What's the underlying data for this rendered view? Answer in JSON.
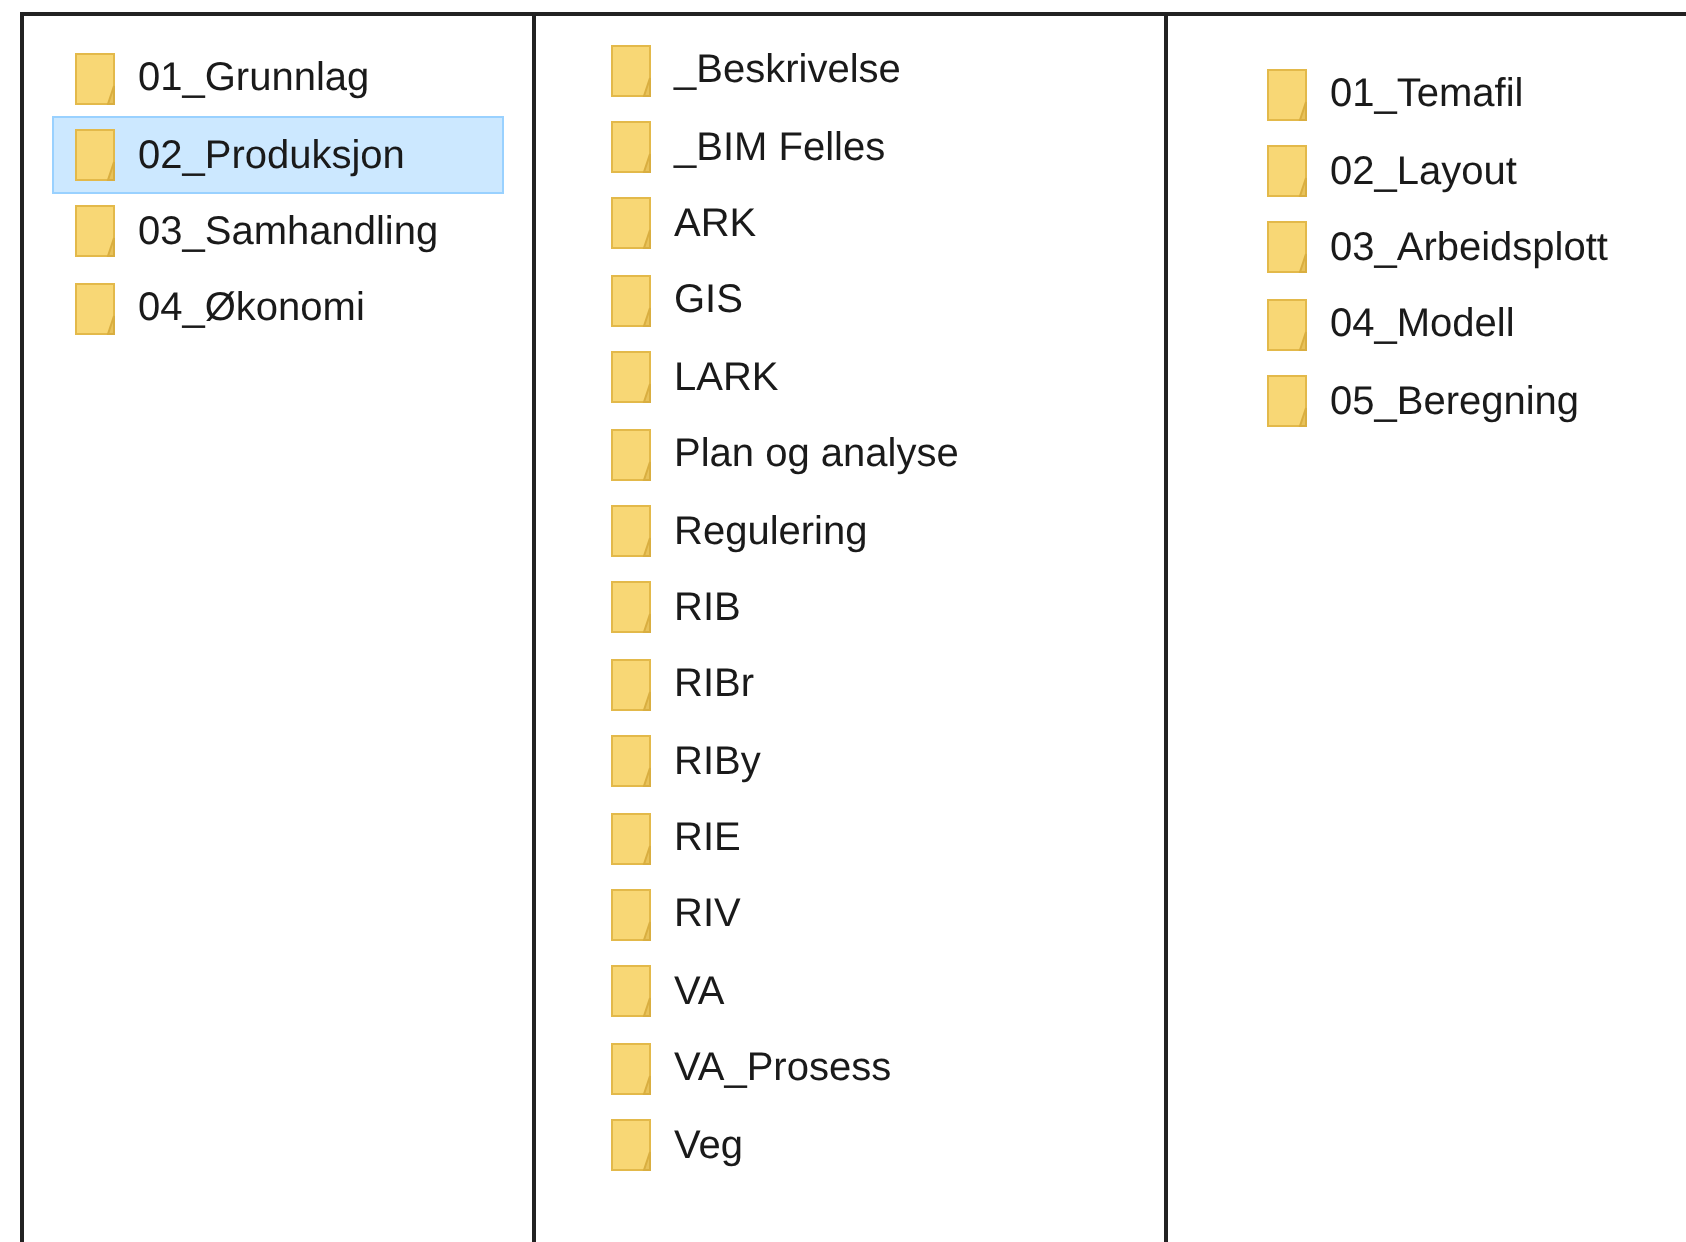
{
  "columns": [
    {
      "items": [
        {
          "label": "01_Grunnlag",
          "selected": false
        },
        {
          "label": "02_Produksjon",
          "selected": true
        },
        {
          "label": "03_Samhandling",
          "selected": false
        },
        {
          "label": "04_Økonomi",
          "selected": false
        }
      ]
    },
    {
      "items": [
        {
          "label": "_Beskrivelse",
          "selected": false
        },
        {
          "label": "_BIM Felles",
          "selected": false
        },
        {
          "label": "ARK",
          "selected": false
        },
        {
          "label": "GIS",
          "selected": false
        },
        {
          "label": "LARK",
          "selected": false
        },
        {
          "label": "Plan og analyse",
          "selected": false
        },
        {
          "label": "Regulering",
          "selected": false
        },
        {
          "label": "RIB",
          "selected": false
        },
        {
          "label": "RIBr",
          "selected": false
        },
        {
          "label": "RIBy",
          "selected": false
        },
        {
          "label": "RIE",
          "selected": false
        },
        {
          "label": "RIV",
          "selected": false
        },
        {
          "label": "VA",
          "selected": false
        },
        {
          "label": "VA_Prosess",
          "selected": false
        },
        {
          "label": "Veg",
          "selected": false
        }
      ]
    },
    {
      "items": [
        {
          "label": "01_Temafil",
          "selected": false
        },
        {
          "label": "02_Layout",
          "selected": false
        },
        {
          "label": "03_Arbeidsplott",
          "selected": false
        },
        {
          "label": "04_Modell",
          "selected": false
        },
        {
          "label": "05_Beregning",
          "selected": false
        }
      ]
    }
  ]
}
